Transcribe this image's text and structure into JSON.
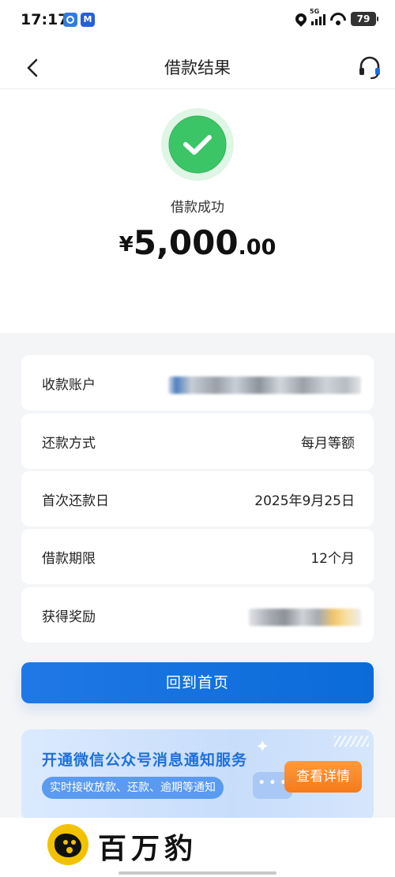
{
  "status_bar": {
    "time": "17:17",
    "app_badge": "M",
    "network": "5G",
    "battery": "79"
  },
  "nav": {
    "title": "借款结果",
    "back_icon": "chevron-left-icon",
    "service_icon": "headset-icon"
  },
  "result": {
    "status_text": "借款成功",
    "status_icon": "checkmark-circle-icon",
    "currency": "¥",
    "amount_int": "5,000",
    "amount_dec": ".00",
    "accent_color": "#34c759"
  },
  "details": [
    {
      "label": "收款账户",
      "value": ""
    },
    {
      "label": "还款方式",
      "value": "每月等额"
    },
    {
      "label": "首次还款日",
      "value": "2025年9月25日"
    },
    {
      "label": "借款期限",
      "value": "12个月"
    },
    {
      "label": "获得奖励",
      "value": ""
    }
  ],
  "home_button": {
    "label": "回到首页",
    "color": "#1673e0"
  },
  "banner": {
    "title": "开通微信公众号消息通知服务",
    "subtitle": "实时接收放款、还款、逾期等通知",
    "button": "查看详情",
    "button_color": "#f67a1a"
  },
  "watermark": {
    "text": "百万豹"
  }
}
